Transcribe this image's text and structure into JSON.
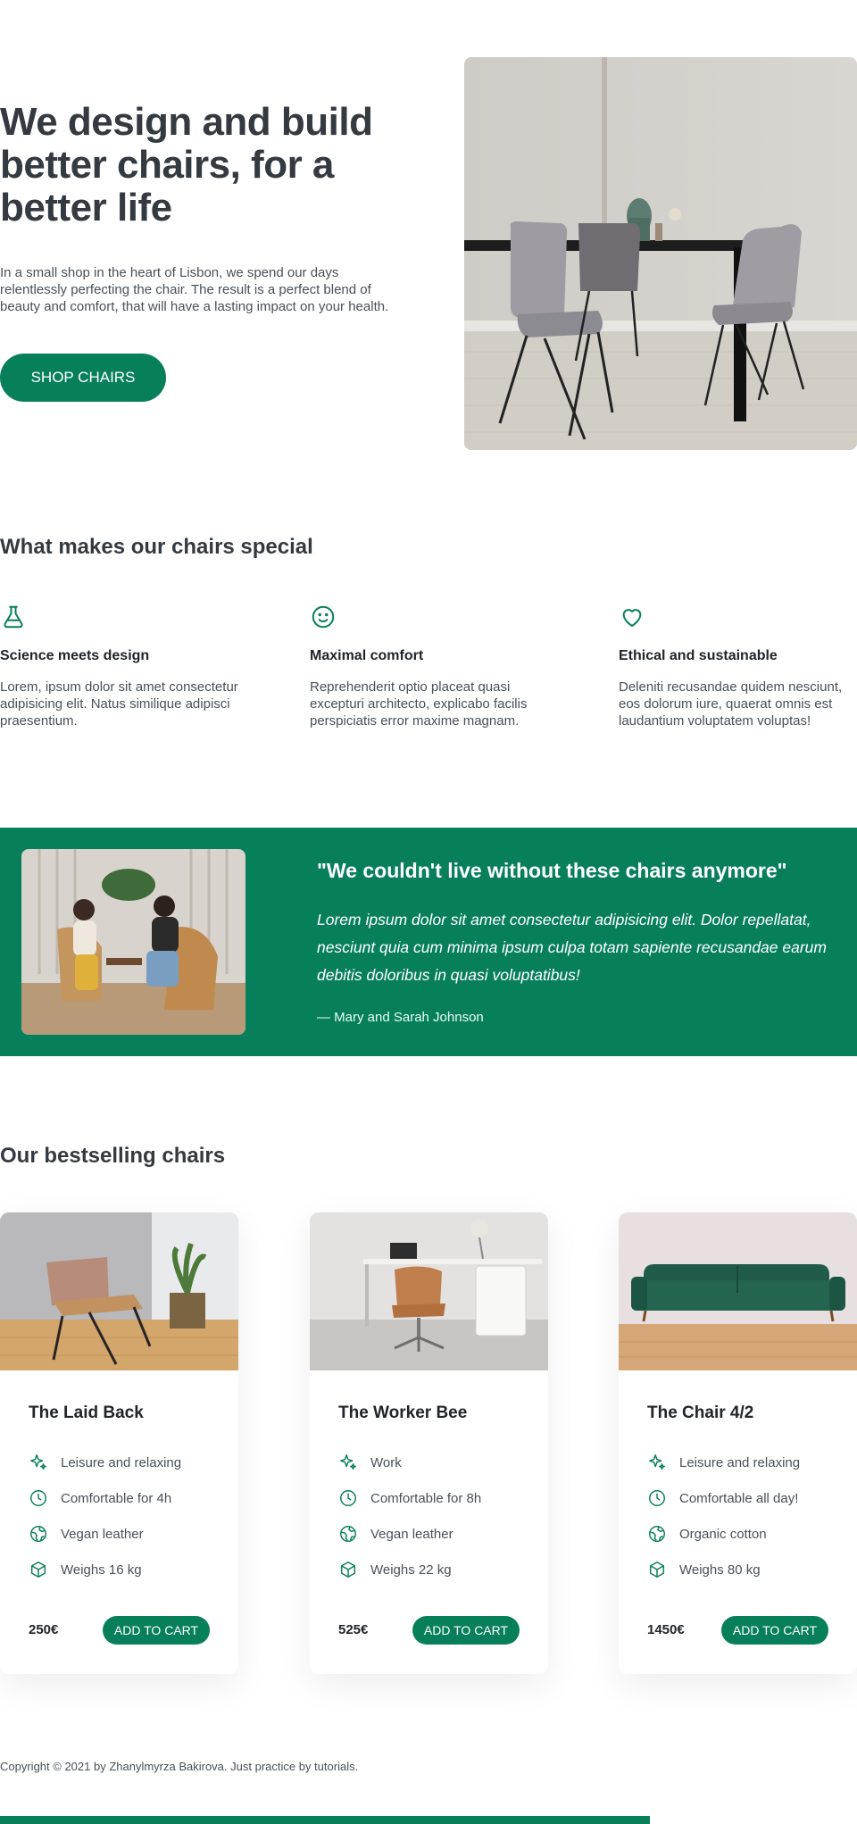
{
  "colors": {
    "primary": "#087f5b",
    "text_dark": "#343a40",
    "text_muted": "#495057",
    "background": "#ffffff"
  },
  "hero": {
    "title": "We design and build better chairs, for a better life",
    "text": "In a small shop in the heart of Lisbon, we spend our days relentlessly perfecting the chair. The result is a perfect blend of beauty and comfort, that will have a lasting impact on your health.",
    "button_label": "SHOP CHAIRS",
    "image": "dining-room-chairs-photo"
  },
  "features": {
    "title": "What makes our chairs special",
    "items": [
      {
        "icon": "flask-icon",
        "title": "Science meets design",
        "text": "Lorem, ipsum dolor sit amet consectetur adipisicing elit. Natus similique adipisci praesentium."
      },
      {
        "icon": "smile-icon",
        "title": "Maximal comfort",
        "text": "Reprehenderit optio placeat quasi excepturi architecto, explicabo facilis perspiciatis error maxime magnam."
      },
      {
        "icon": "heart-icon",
        "title": "Ethical and sustainable",
        "text": "Deleniti recusandae quidem nesciunt, eos dolorum iure, quaerat omnis est laudantium voluptatem voluptas!"
      }
    ]
  },
  "testimonial": {
    "quote_title": "\"We couldn't live without these chairs anymore\"",
    "text": "Lorem ipsum dolor sit amet consectetur adipisicing elit. Dolor repellatat, nesciunt quia cum minima ipsum culpa totam sapiente recusandae earum debitis doloribus in quasi voluptatibus!",
    "author": "— Mary and Sarah Johnson",
    "image": "two-women-chatting-photo"
  },
  "products": {
    "title": "Our bestselling chairs",
    "cart_label": "ADD TO CART",
    "items": [
      {
        "name": "The Laid Back",
        "price": "250€",
        "features": [
          "Leisure and relaxing",
          "Comfortable for 4h",
          "Vegan leather",
          "Weighs 16 kg"
        ]
      },
      {
        "name": "The Worker Bee",
        "price": "525€",
        "features": [
          "Work",
          "Comfortable for 8h",
          "Vegan leather",
          "Weighs 22 kg"
        ]
      },
      {
        "name": "The Chair 4/2",
        "price": "1450€",
        "features": [
          "Leisure and relaxing",
          "Comfortable all day!",
          "Organic cotton",
          "Weighs 80 kg"
        ]
      }
    ],
    "feature_icons": [
      "sparkles-icon",
      "clock-icon",
      "globe-icon",
      "box-icon"
    ]
  },
  "footer": {
    "copyright": "Copyright © 2021 by Zhanylmyrza Bakirova. Just practice by tutorials."
  }
}
